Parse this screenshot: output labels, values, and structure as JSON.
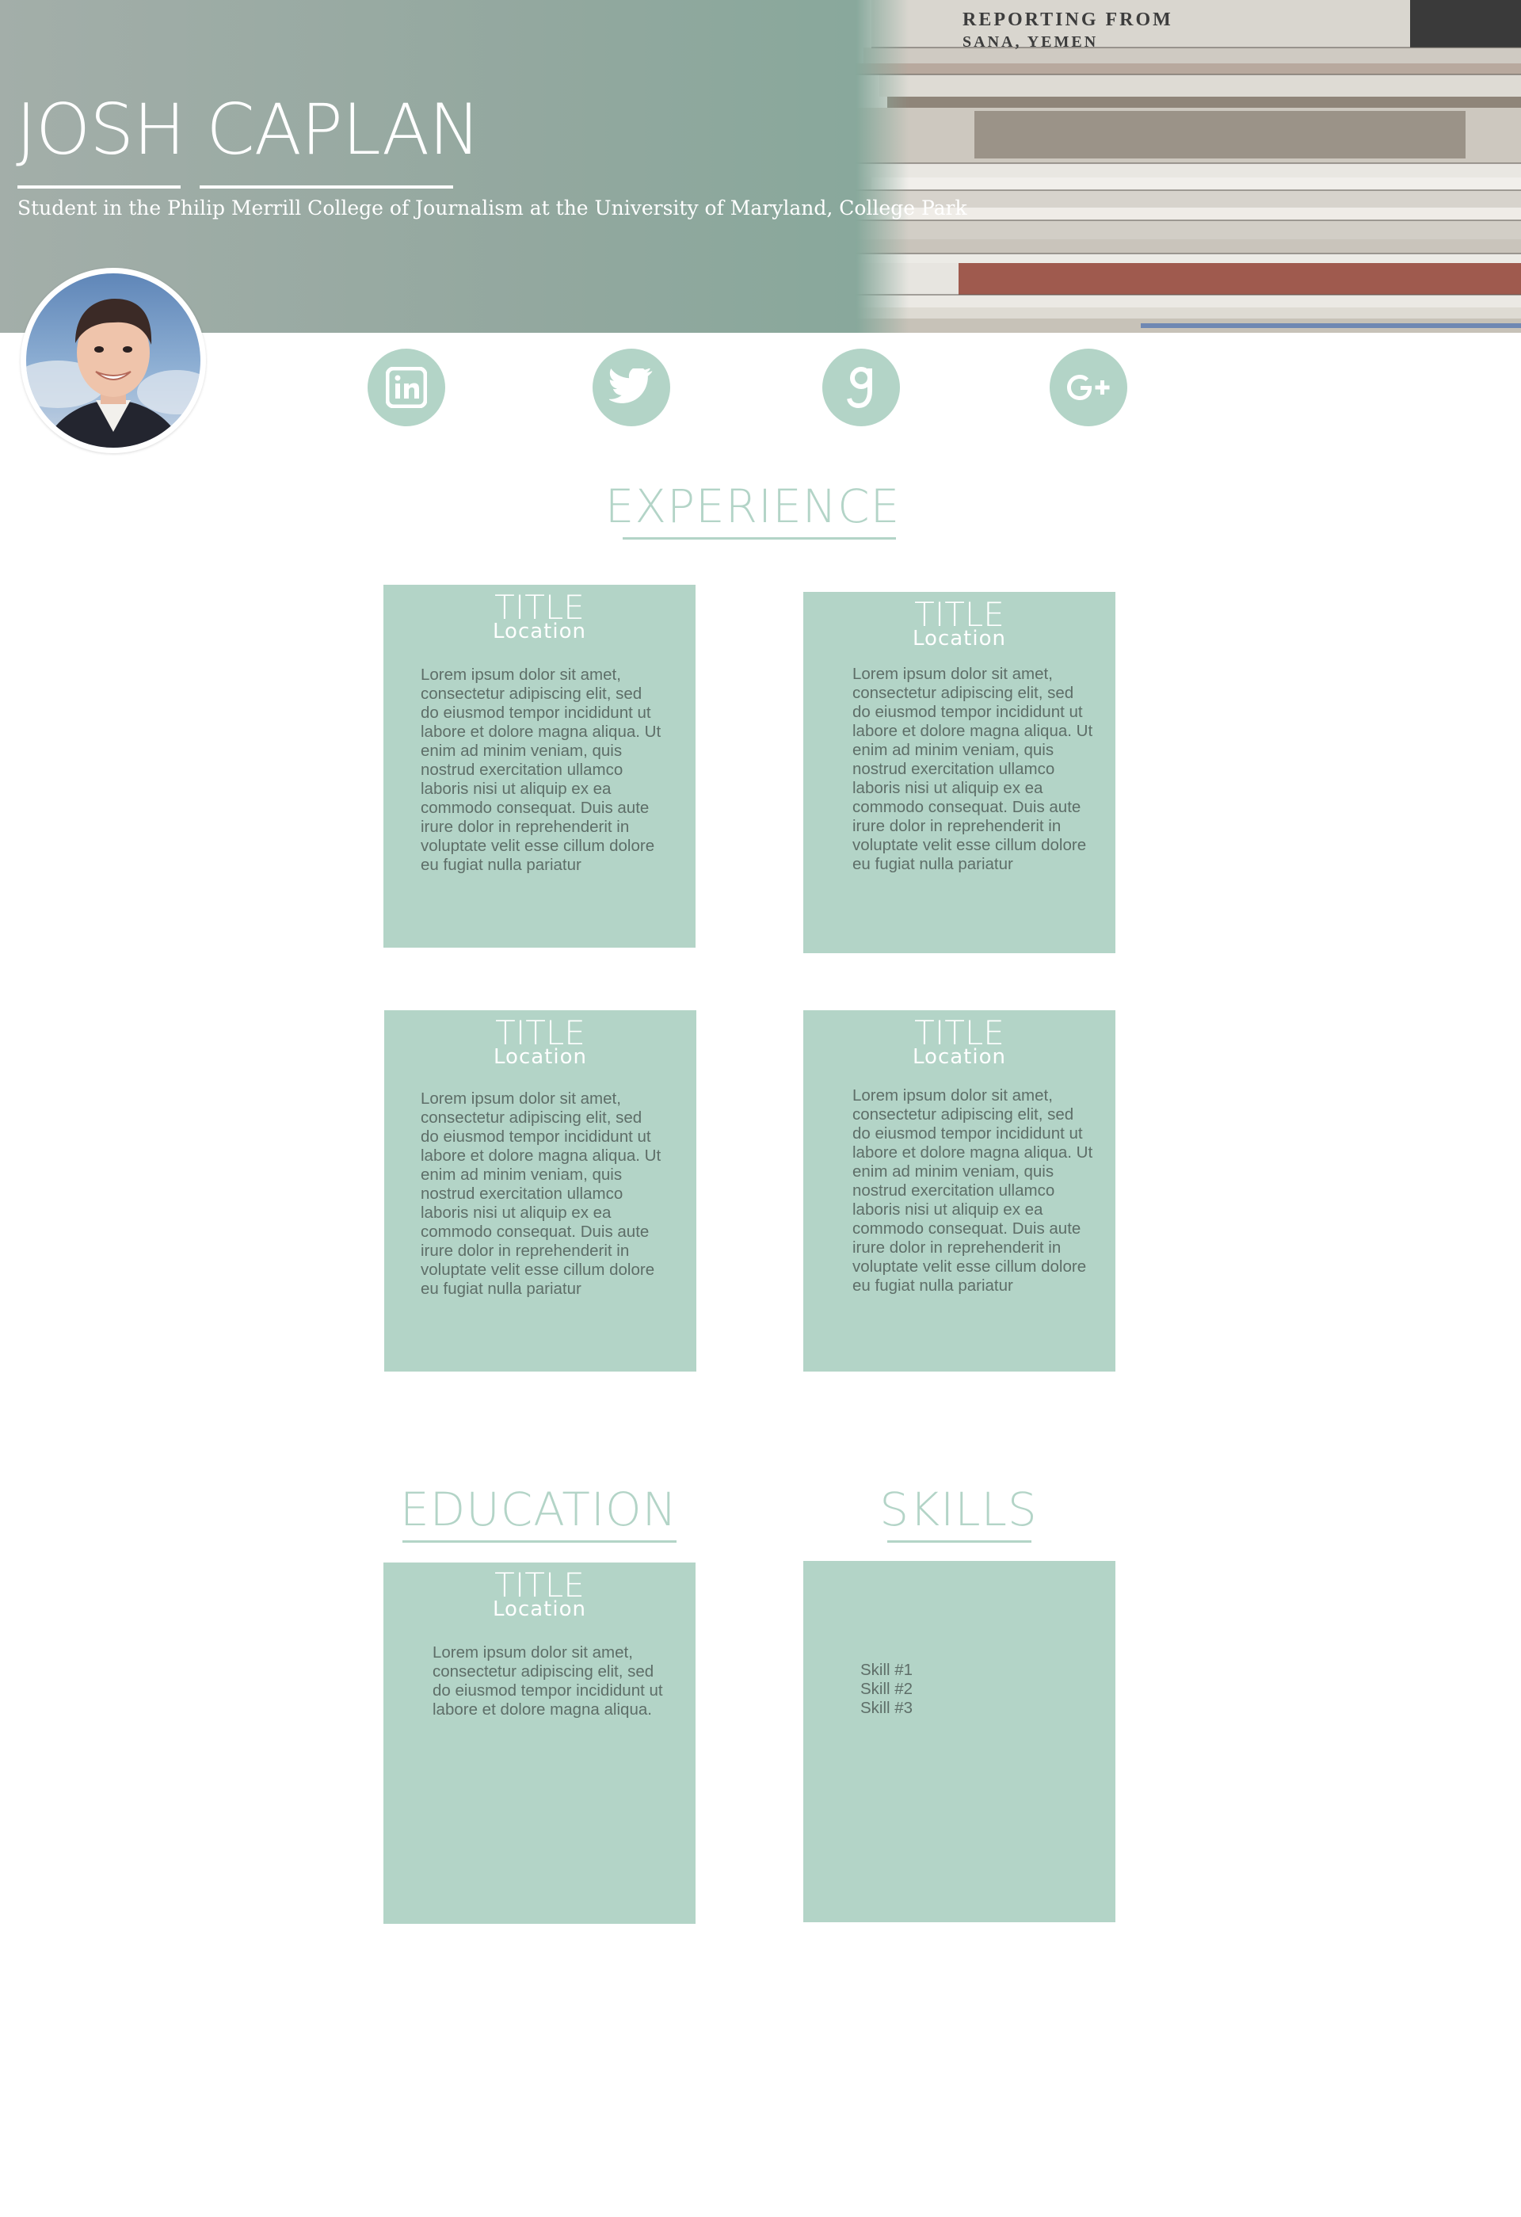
{
  "header": {
    "name": "JOSH CAPLAN",
    "subtitle": "Student in the Philip Merrill College of Journalism at the University of Maryland, College Park",
    "background_image": "newspaper-stack",
    "newspaper_text": {
      "line1": "REPORTING FROM",
      "line2": "SANA, YEMEN"
    }
  },
  "avatar": {
    "alt": "Profile photo of Josh Caplan"
  },
  "social": [
    {
      "name": "linkedin-icon",
      "label": "in"
    },
    {
      "name": "twitter-icon",
      "label": "twitter"
    },
    {
      "name": "goodreads-icon",
      "label": "g"
    },
    {
      "name": "google-plus-icon",
      "label": "G+"
    }
  ],
  "experience": {
    "heading": "EXPERIENCE",
    "cards": [
      {
        "title": "TITLE",
        "location": "Location",
        "body": "Lorem ipsum dolor sit amet,\nconsectetur adipiscing elit, sed\ndo eiusmod tempor incididunt ut\nlabore et dolore magna aliqua. Ut\nenim ad minim veniam, quis\nnostrud exercitation ullamco\nlaboris nisi ut aliquip ex ea\ncommodo consequat. Duis aute\nirure dolor in reprehenderit in\nvoluptate velit esse cillum dolore\neu fugiat nulla pariatur"
      },
      {
        "title": "TITLE",
        "location": "Location",
        "body": "Lorem ipsum dolor sit amet,\nconsectetur adipiscing elit, sed\ndo eiusmod tempor incididunt ut\nlabore et dolore magna aliqua. Ut\nenim ad minim veniam, quis\nnostrud exercitation ullamco\nlaboris nisi ut aliquip ex ea\ncommodo consequat. Duis aute\nirure dolor in reprehenderit in\nvoluptate velit esse cillum dolore\neu fugiat nulla pariatur"
      },
      {
        "title": "TITLE",
        "location": "Location",
        "body": "Lorem ipsum dolor sit amet,\nconsectetur adipiscing elit, sed\ndo eiusmod tempor incididunt ut\nlabore et dolore magna aliqua. Ut\nenim ad minim veniam, quis\nnostrud exercitation ullamco\nlaboris nisi ut aliquip ex ea\ncommodo consequat. Duis aute\nirure dolor in reprehenderit in\nvoluptate velit esse cillum dolore\neu fugiat nulla pariatur"
      },
      {
        "title": "TITLE",
        "location": "Location",
        "body": "Lorem ipsum dolor sit amet,\nconsectetur adipiscing elit, sed\ndo eiusmod tempor incididunt ut\nlabore et dolore magna aliqua. Ut\nenim ad minim veniam, quis\nnostrud exercitation ullamco\nlaboris nisi ut aliquip ex ea\ncommodo consequat. Duis aute\nirure dolor in reprehenderit in\nvoluptate velit esse cillum dolore\neu fugiat nulla pariatur"
      }
    ]
  },
  "education": {
    "heading": "EDUCATION",
    "card": {
      "title": "TITLE",
      "location": "Location",
      "body": "Lorem ipsum dolor sit amet,\nconsectetur adipiscing elit, sed\ndo eiusmod tempor incididunt ut\nlabore et dolore magna aliqua."
    }
  },
  "skills": {
    "heading": "SKILLS",
    "items": [
      "Skill #1",
      "Skill #2",
      "Skill #3"
    ]
  },
  "colors": {
    "accent": "#b3d4c7",
    "header_green": "#87a89b",
    "body_text": "#5e6e68",
    "white": "#ffffff"
  }
}
